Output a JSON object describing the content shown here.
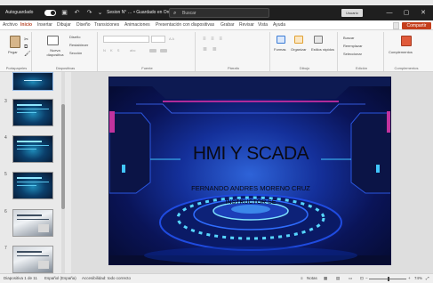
{
  "titlebar": {
    "autosave_label": "Autoguardado",
    "autosave_state": "off",
    "doc_title": "Sesion N° … • Guardado en OneDrive ∨",
    "search_placeholder": "Buscar",
    "user_label": "Usuario",
    "undo_icon": "undo-icon",
    "redo_icon": "redo-icon",
    "save_icon": "save-icon",
    "minimize": "—",
    "maximize": "▢",
    "close": "✕"
  },
  "tabs": [
    "Archivo",
    "Inicio",
    "Insertar",
    "Dibujar",
    "Diseño",
    "Transiciones",
    "Animaciones",
    "Presentación con diapositivas",
    "Grabar",
    "Revisar",
    "Vista",
    "Ayuda"
  ],
  "active_tab_index": 1,
  "share_label": "Compartir",
  "ribbon": {
    "groups": [
      {
        "label": "Portapapeles",
        "buttons": [
          "Pegar"
        ]
      },
      {
        "label": "Diapositivas",
        "buttons": [
          "Nueva diapositiva",
          "Diseño",
          "Restablecer",
          "Sección"
        ]
      },
      {
        "label": "Fuente",
        "buttons": [
          "A A",
          "N K S",
          "abc"
        ]
      },
      {
        "label": "Párrafo",
        "buttons": [
          "≡ ≡ ≡",
          "≣ ≣"
        ]
      },
      {
        "label": "Dibujo",
        "buttons": [
          "Formas",
          "Organizar",
          "Estilos rápidos"
        ]
      },
      {
        "label": "Edición",
        "buttons": [
          "Buscar",
          "Reemplazar",
          "Seleccionar"
        ]
      },
      {
        "label": "Complementos",
        "buttons": [
          "Complementos"
        ]
      }
    ]
  },
  "thumbnails": [
    {
      "num": "",
      "style": "first"
    },
    {
      "num": "3",
      "style": "dark"
    },
    {
      "num": "4",
      "style": "dark"
    },
    {
      "num": "5",
      "style": "dark"
    },
    {
      "num": "6",
      "style": "light"
    },
    {
      "num": "7",
      "style": "light"
    }
  ],
  "slide": {
    "title": "HMI Y SCADA",
    "author": "FERNANDO ANDRES MORENO CRUZ",
    "role": "INSTRUCTOR SE"
  },
  "statusbar": {
    "slide_counter": "Diapositiva 1 de 11",
    "language": "Español (España)",
    "accessibility": "Accesibilidad: todo correcto",
    "notes_label": "Notas",
    "zoom_label": "74%"
  },
  "colors": {
    "accent": "#c43e1c",
    "titlebar": "#1f1f1f",
    "slide_bg": "#14309a"
  }
}
